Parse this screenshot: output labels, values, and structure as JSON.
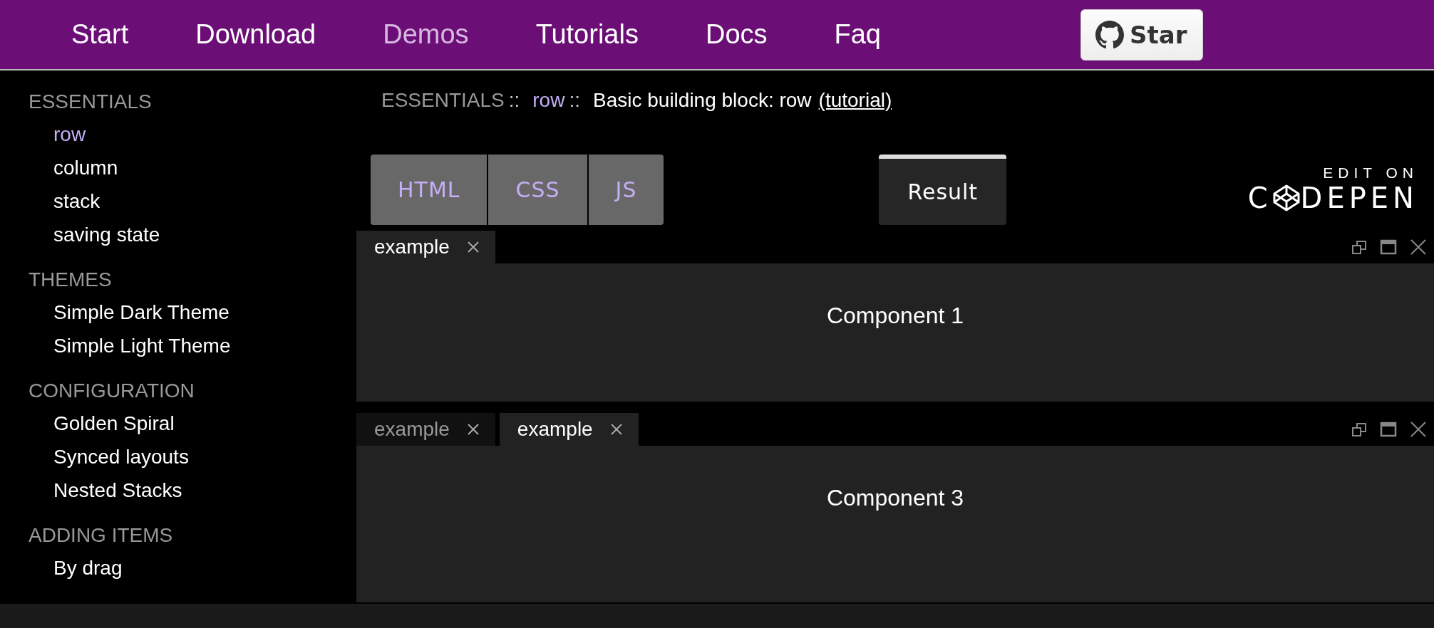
{
  "nav": {
    "items": [
      {
        "label": "Start",
        "selected": false
      },
      {
        "label": "Download",
        "selected": false
      },
      {
        "label": "Demos",
        "selected": true
      },
      {
        "label": "Tutorials",
        "selected": false
      },
      {
        "label": "Docs",
        "selected": false
      },
      {
        "label": "Faq",
        "selected": false
      }
    ],
    "star_button": {
      "label": "Star"
    }
  },
  "sidebar": {
    "sections": [
      {
        "heading": "ESSENTIALS",
        "items": [
          {
            "label": "row",
            "selected": true
          },
          {
            "label": "column",
            "selected": false
          },
          {
            "label": "stack",
            "selected": false
          },
          {
            "label": "saving state",
            "selected": false
          }
        ]
      },
      {
        "heading": "THEMES",
        "items": [
          {
            "label": "Simple Dark Theme",
            "selected": false
          },
          {
            "label": "Simple Light Theme",
            "selected": false
          }
        ]
      },
      {
        "heading": "CONFIGURATION",
        "items": [
          {
            "label": "Golden Spiral",
            "selected": false
          },
          {
            "label": "Synced layouts",
            "selected": false
          },
          {
            "label": "Nested Stacks",
            "selected": false
          }
        ]
      },
      {
        "heading": "ADDING ITEMS",
        "items": [
          {
            "label": "By drag",
            "selected": false
          }
        ]
      }
    ]
  },
  "breadcrumb": {
    "section": "ESSENTIALS",
    "separator_1": "::",
    "item": "row",
    "separator_2": "::",
    "title": "Basic building block: row",
    "link": "(tutorial)"
  },
  "codepen": {
    "tabs": [
      {
        "label": "HTML",
        "selected": false
      },
      {
        "label": "CSS",
        "selected": false
      },
      {
        "label": "JS",
        "selected": false
      },
      {
        "label": "Result",
        "selected": true
      }
    ],
    "caption": "EDIT ON",
    "wordmark_start": "C",
    "wordmark_end": "DEPEN"
  },
  "stacks": [
    {
      "tabs": [
        {
          "label": "example",
          "selected": true
        }
      ],
      "content": "Component 1"
    },
    {
      "tabs": [
        {
          "label": "example",
          "selected": false
        },
        {
          "label": "example",
          "selected": true
        }
      ],
      "content": "Component 3"
    }
  ]
}
